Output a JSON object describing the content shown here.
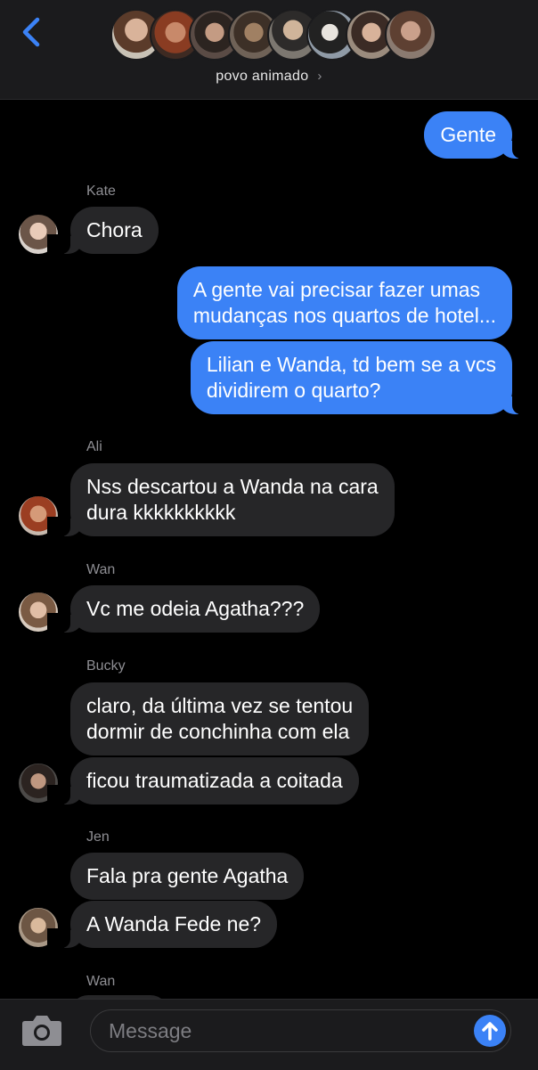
{
  "header": {
    "back_icon": "chevron-left-icon",
    "group_name": "povo animado",
    "group_chevron": "›",
    "participant_avatars": [
      "avatar-1",
      "avatar-2",
      "avatar-3",
      "avatar-4",
      "avatar-5",
      "avatar-6",
      "avatar-7",
      "avatar-8"
    ]
  },
  "messages": [
    {
      "direction": "out",
      "text_lines": [
        "Gente"
      ]
    },
    {
      "direction": "in",
      "sender": "Kate",
      "text_lines": [
        "Chora"
      ]
    },
    {
      "direction": "out",
      "text_lines": [
        "A gente vai precisar fazer umas",
        "mudanças nos quartos de hotel..."
      ]
    },
    {
      "direction": "out",
      "text_lines": [
        "Lilian e Wanda, td bem se a vcs",
        "dividirem o quarto?"
      ]
    },
    {
      "direction": "in",
      "sender": "Ali",
      "text_lines": [
        "Nss descartou a Wanda na cara",
        "dura kkkkkkkkkk"
      ]
    },
    {
      "direction": "in",
      "sender": "Wan",
      "text_lines": [
        "Vc me odeia Agatha???"
      ]
    },
    {
      "direction": "in",
      "sender": "Bucky",
      "text_lines": [
        "claro, da última vez se tentou",
        "dormir de conchinha com ela"
      ]
    },
    {
      "direction": "in",
      "text_lines": [
        "ficou traumatizada a coitada"
      ]
    },
    {
      "direction": "in",
      "sender": "Jen",
      "text_lines": [
        "Fala pra gente Agatha"
      ]
    },
    {
      "direction": "in",
      "text_lines": [
        "A Wanda Fede ne?"
      ]
    },
    {
      "direction": "in",
      "sender": "Wan",
      "text_lines": []
    }
  ],
  "input": {
    "placeholder": "Message",
    "camera_icon": "camera-icon",
    "send_icon": "arrow-up-icon"
  },
  "colors": {
    "accent": "#3b82f6",
    "incoming_bubble": "#262628",
    "header_bg": "#1b1b1d"
  }
}
